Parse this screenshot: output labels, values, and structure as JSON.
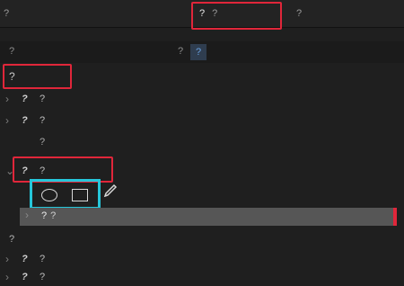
{
  "tabs": {
    "source": "?",
    "effect_controls": "?",
    "close": "?",
    "mixer": "?"
  },
  "clip": {
    "master": "?",
    "separator": "?",
    "sequence": "?"
  },
  "sections": {
    "video_effects": "?",
    "audio_effects": "?"
  },
  "video_rows": [
    {
      "fx": "?",
      "label": "?"
    },
    {
      "fx": "?",
      "label": "?"
    },
    {
      "label": "?"
    },
    {
      "fx": "?",
      "label": "?"
    }
  ],
  "mask_row": {
    "label": "?",
    "count": "?"
  },
  "audio_rows": [
    {
      "fx": "?",
      "label": "?"
    },
    {
      "fx": "?",
      "label": "?"
    }
  ],
  "colors": {
    "highlight_red": "#e0263a",
    "highlight_cyan": "#26c6da",
    "selected_row": "#565656",
    "link_blue": "#6aa2e0"
  }
}
